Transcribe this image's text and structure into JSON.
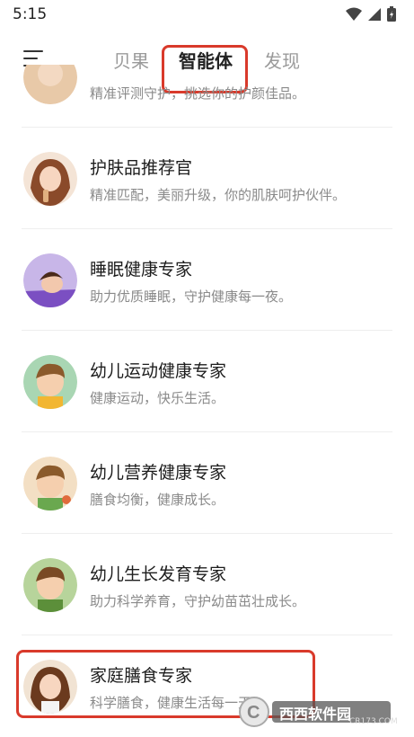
{
  "status_bar": {
    "time": "5:15"
  },
  "tabs": [
    {
      "label": "贝果",
      "active": false
    },
    {
      "label": "智能体",
      "active": true
    },
    {
      "label": "发现",
      "active": false
    }
  ],
  "partial_item": {
    "desc": "精准评测守护，挑选你的护颜佳品。"
  },
  "items": [
    {
      "title": "护肤品推荐官",
      "desc": "精准匹配，美丽升级，你的肌肤呵护伙伴。"
    },
    {
      "title": "睡眠健康专家",
      "desc": "助力优质睡眠，守护健康每一夜。"
    },
    {
      "title": "幼儿运动健康专家",
      "desc": "健康运动，快乐生活。"
    },
    {
      "title": "幼儿营养健康专家",
      "desc": "膳食均衡，健康成长。"
    },
    {
      "title": "幼儿生长发育专家",
      "desc": "助力科学养育，守护幼苗茁壮成长。"
    },
    {
      "title": "家庭膳食专家",
      "desc": "科学膳食，健康生活每一天"
    }
  ],
  "watermark": {
    "text": "西西软件园",
    "subtext": "CR173.COM"
  },
  "colors": {
    "highlight": "#d93a2b",
    "accent_text": "#222222",
    "muted_text": "#8a8a8a"
  }
}
